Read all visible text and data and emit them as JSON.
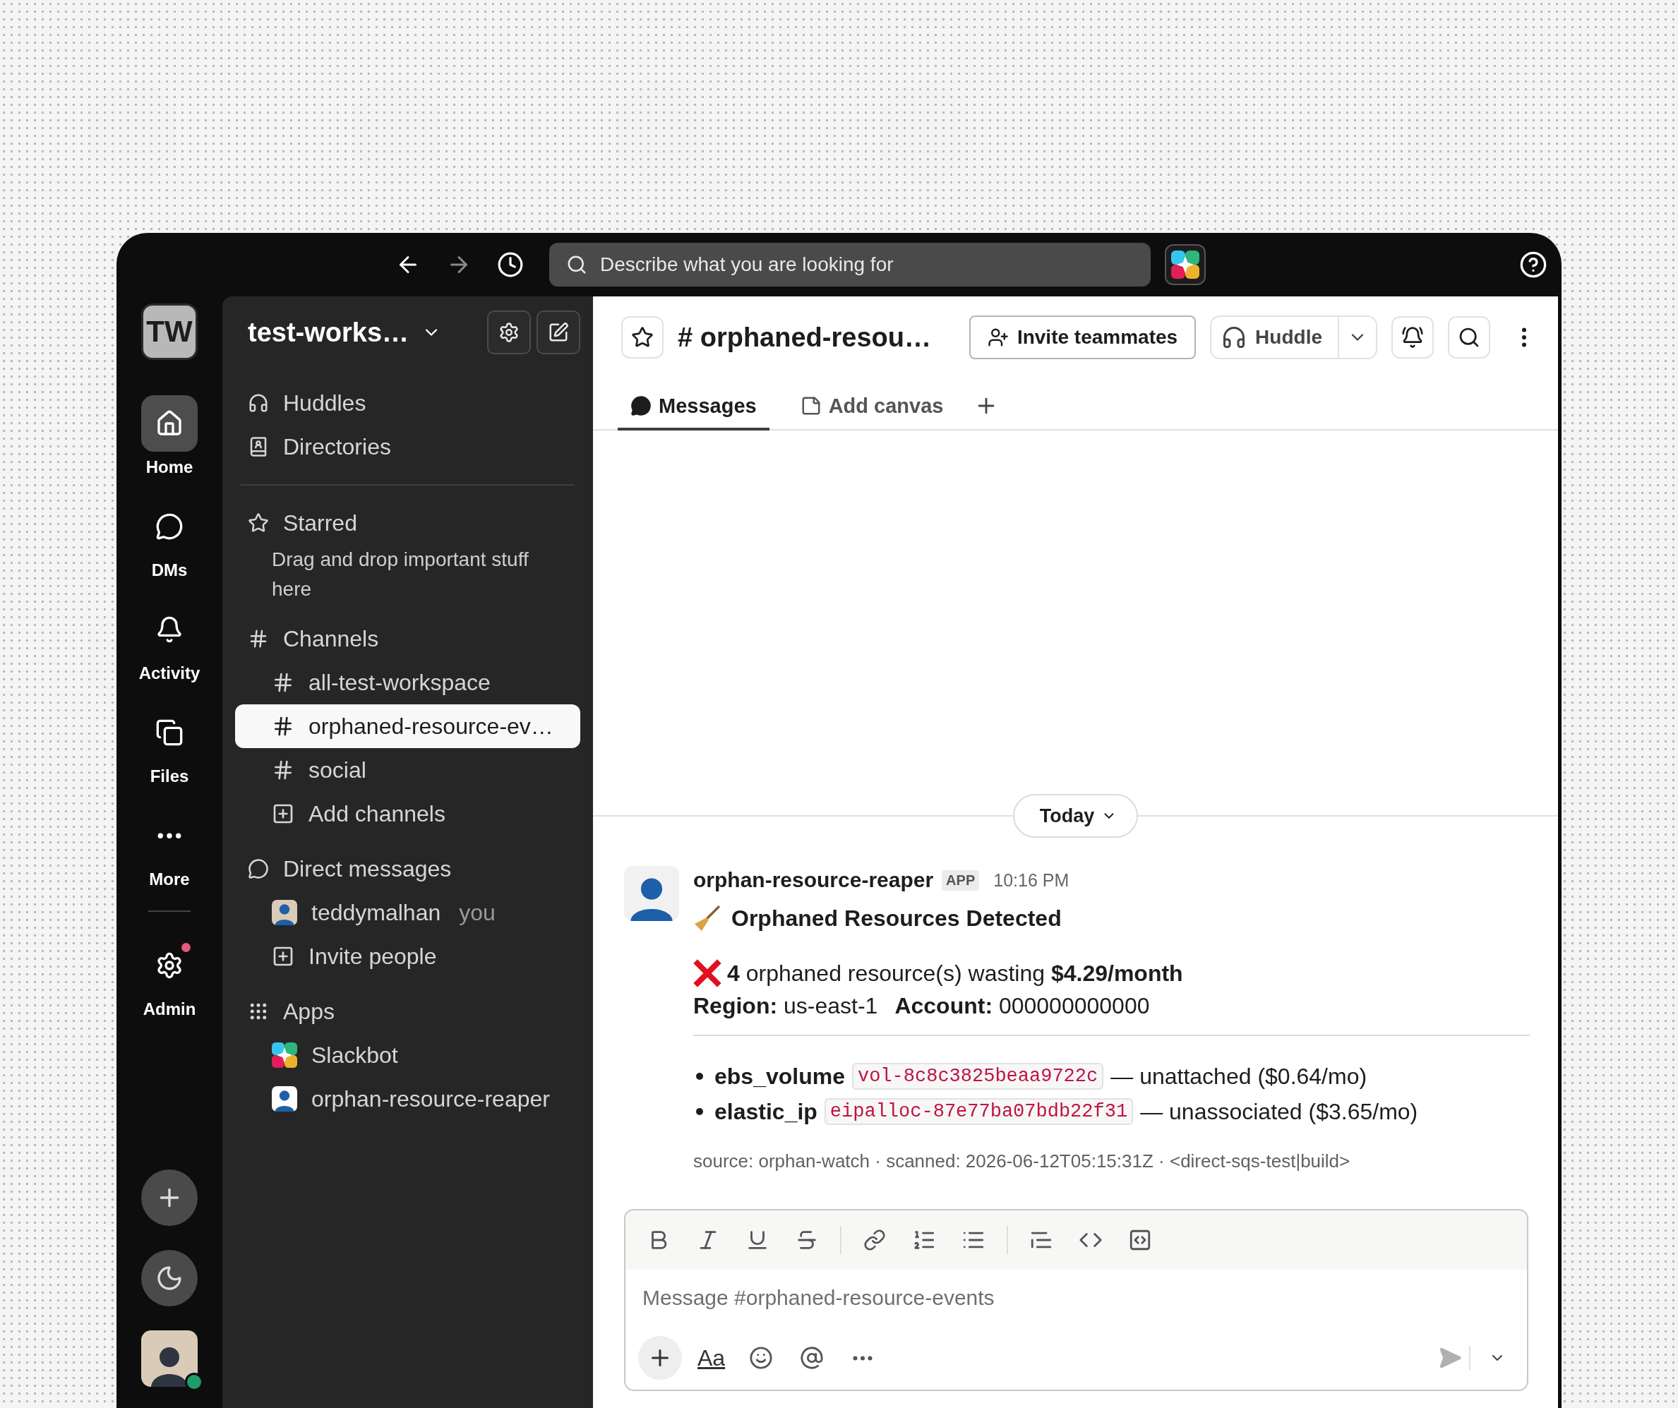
{
  "topbar": {
    "search_placeholder": "Describe what you are looking for"
  },
  "rail": {
    "workspace_initials": "TW",
    "items": [
      {
        "label": "Home",
        "selected": true,
        "notification": false
      },
      {
        "label": "DMs",
        "selected": false,
        "notification": false
      },
      {
        "label": "Activity",
        "selected": false,
        "notification": false
      },
      {
        "label": "Files",
        "selected": false,
        "notification": false
      },
      {
        "label": "More",
        "selected": false,
        "notification": false
      },
      {
        "label": "Admin",
        "selected": false,
        "notification": true
      }
    ]
  },
  "sidebar": {
    "workspace": "test-works…",
    "nav": [
      {
        "label": "Huddles"
      },
      {
        "label": "Directories"
      }
    ],
    "starred": {
      "title": "Starred",
      "hint": "Drag and drop important stuff here"
    },
    "channels": {
      "title": "Channels",
      "add": "Add channels",
      "items": [
        {
          "name": "all-test-workspace",
          "selected": false
        },
        {
          "name": "orphaned-resource-ev…",
          "selected": true
        },
        {
          "name": "social",
          "selected": false
        }
      ]
    },
    "direct_messages": {
      "title": "Direct messages",
      "add": "Invite people",
      "items": [
        {
          "name": "teddymalhan",
          "suffix": "you"
        }
      ]
    },
    "apps": {
      "title": "Apps",
      "items": [
        {
          "name": "Slackbot",
          "kind": "slackbot"
        },
        {
          "name": "orphan-resource-reaper",
          "kind": "person"
        }
      ]
    }
  },
  "channel_header": {
    "title": "# orphaned-resou…",
    "invite": "Invite teammates",
    "huddle": "Huddle",
    "tabs": [
      {
        "label": "Messages",
        "selected": true
      },
      {
        "label": "Add canvas",
        "selected": false
      }
    ]
  },
  "date_divider": "Today",
  "message": {
    "author": "orphan-resource-reaper",
    "badge": "APP",
    "time": "10:16 PM",
    "heading": "Orphaned Resources Detected",
    "summary": "**4** orphaned resource(s) wasting **$4.29/month**",
    "meta": [
      "**Region:** us-east-1",
      "**Account:** 000000000000"
    ],
    "resources": [
      {
        "type": "ebs_volume",
        "id": "vol-8c8c3825beaa9722c",
        "note": "— unattached ($0.64/mo)"
      },
      {
        "type": "elastic_ip",
        "id": "eipalloc-87e77ba07bdb22f31",
        "note": "— unassociated ($3.65/mo)"
      }
    ],
    "footer": "source: orphan-watch · scanned: 2026-06-12T05:15:31Z · <direct-sqs-test|build>"
  },
  "composer": {
    "placeholder": "Message #orphaned-resource-events",
    "format_label": "Aa"
  }
}
